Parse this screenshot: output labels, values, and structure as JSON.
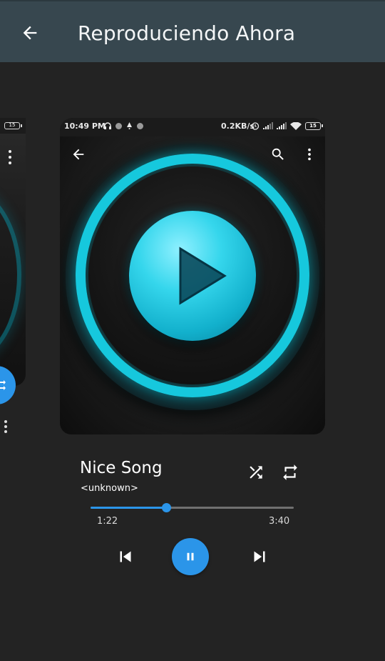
{
  "app_bar": {
    "title": "Reproduciendo Ahora",
    "back_icon": "arrow-back-icon",
    "background_color": "#37474f"
  },
  "card_screenshot": {
    "status_bar": {
      "time": "10:49 PM",
      "speed": "0.2KB/s",
      "battery": "15"
    },
    "toolbar_icons": [
      "arrow-back-icon",
      "search-icon",
      "more-vert-icon"
    ],
    "art": "neon-play-button-artwork"
  },
  "left_card": {
    "battery": "15"
  },
  "song": {
    "title": "Nice Song",
    "artist": "<unknown>"
  },
  "player": {
    "elapsed": "1:22",
    "duration": "3:40",
    "progress_fraction": 0.373,
    "accent_color": "#2b95e9",
    "state": "playing",
    "controls": [
      "shuffle-icon",
      "repeat-icon",
      "skip-previous-icon",
      "pause-icon",
      "skip-next-icon"
    ]
  }
}
